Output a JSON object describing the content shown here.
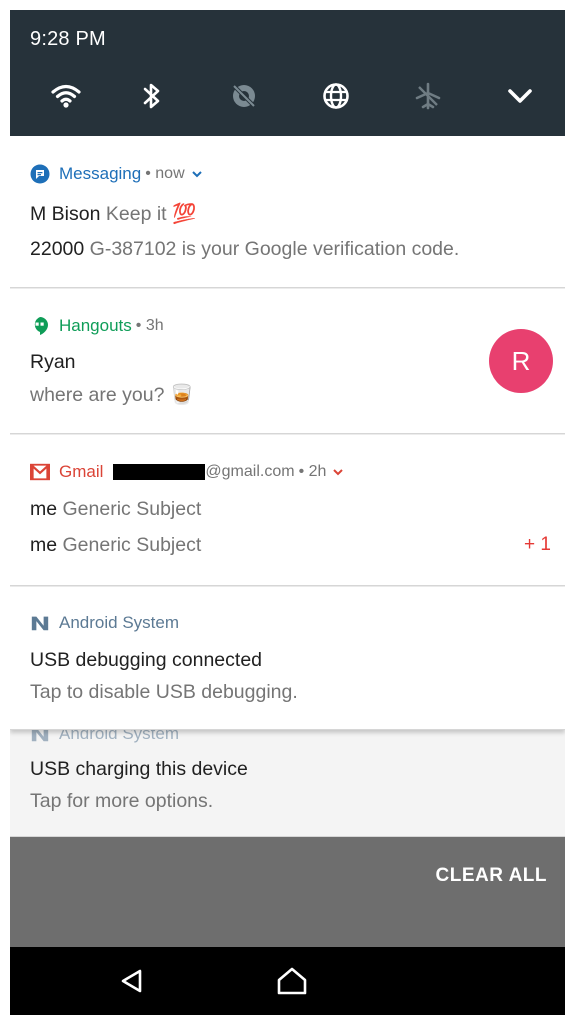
{
  "status_bar": {
    "time": "9:28 PM"
  },
  "quick_settings": {
    "icons": [
      "wifi-icon",
      "bluetooth-icon",
      "data-saver-icon",
      "globe-icon",
      "airplane-mode-icon",
      "chevron-down-icon"
    ]
  },
  "notifications": [
    {
      "app": "Messaging",
      "meta": "• now",
      "accent": "#1e6fb8",
      "line1_sender": "M Bison",
      "line1_text": "Keep it 💯",
      "line2_sender": "22000",
      "line2_text": "G-387102 is your Google verification code."
    },
    {
      "app": "Hangouts",
      "meta": "• 3h",
      "accent": "#0f9d58",
      "title": "Ryan",
      "text": "where are you? 🥃",
      "avatar_letter": "R",
      "avatar_color": "#e8406f"
    },
    {
      "app": "Gmail",
      "account_suffix": "@gmail.com",
      "meta": "• 2h",
      "accent": "#db4437",
      "line1_sender": "me",
      "line1_text": "Generic Subject",
      "line2_sender": "me",
      "line2_text": "Generic Subject",
      "more_count": "+ 1"
    },
    {
      "app": "Android System",
      "accent": "#5c7a94",
      "title": "USB debugging connected",
      "text": "Tap to disable USB debugging."
    },
    {
      "app": "Android System",
      "title": "USB charging this device",
      "text": "Tap for more options."
    }
  ],
  "clear_all": "CLEAR ALL",
  "nav": [
    "back-icon",
    "home-icon"
  ]
}
